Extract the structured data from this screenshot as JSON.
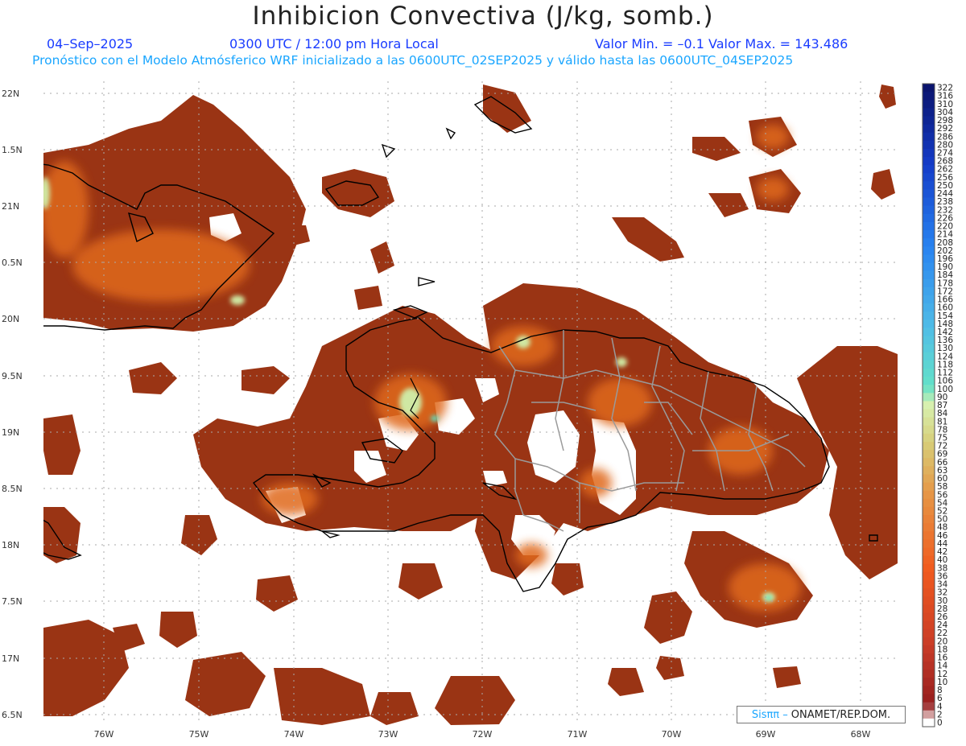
{
  "header": {
    "title": "Inhibicion Convectiva (J/kg, somb.)",
    "date": "04–Sep–2025",
    "time": "0300 UTC / 12:00 pm Hora Local",
    "minmax": "Valor Min. = –0.1  Valor Max. = 143.486",
    "subtitle": "Pronóstico con el Modelo Atmósferico WRF inicializado a las 0600UTC_02SEP2025 y válido hasta las  0600UTC_04SEP2025"
  },
  "axes": {
    "lat_labels": [
      "22N",
      "1.5N",
      "21N",
      "0.5N",
      "20N",
      "9.5N",
      "19N",
      "8.5N",
      "18N",
      "7.5N",
      "17N",
      "6.5N"
    ],
    "lon_labels": [
      "76W",
      "75W",
      "74W",
      "73W",
      "72W",
      "71W",
      "70W",
      "69W",
      "68W"
    ]
  },
  "colorbar": {
    "labels": [
      "322",
      "316",
      "310",
      "304",
      "298",
      "292",
      "286",
      "280",
      "274",
      "268",
      "262",
      "256",
      "250",
      "244",
      "238",
      "232",
      "226",
      "220",
      "214",
      "208",
      "202",
      "196",
      "190",
      "184",
      "178",
      "172",
      "166",
      "160",
      "154",
      "148",
      "142",
      "136",
      "130",
      "124",
      "118",
      "112",
      "106",
      "100",
      "90",
      "87",
      "84",
      "81",
      "78",
      "75",
      "72",
      "69",
      "66",
      "63",
      "60",
      "58",
      "56",
      "54",
      "52",
      "50",
      "48",
      "46",
      "44",
      "42",
      "40",
      "38",
      "36",
      "34",
      "32",
      "30",
      "28",
      "26",
      "24",
      "22",
      "20",
      "18",
      "16",
      "14",
      "12",
      "10",
      "8",
      "6",
      "4",
      "2",
      "0"
    ]
  },
  "footer": {
    "brand": "Sisππ –",
    "org": "ONAMET/REP.DOM."
  }
}
